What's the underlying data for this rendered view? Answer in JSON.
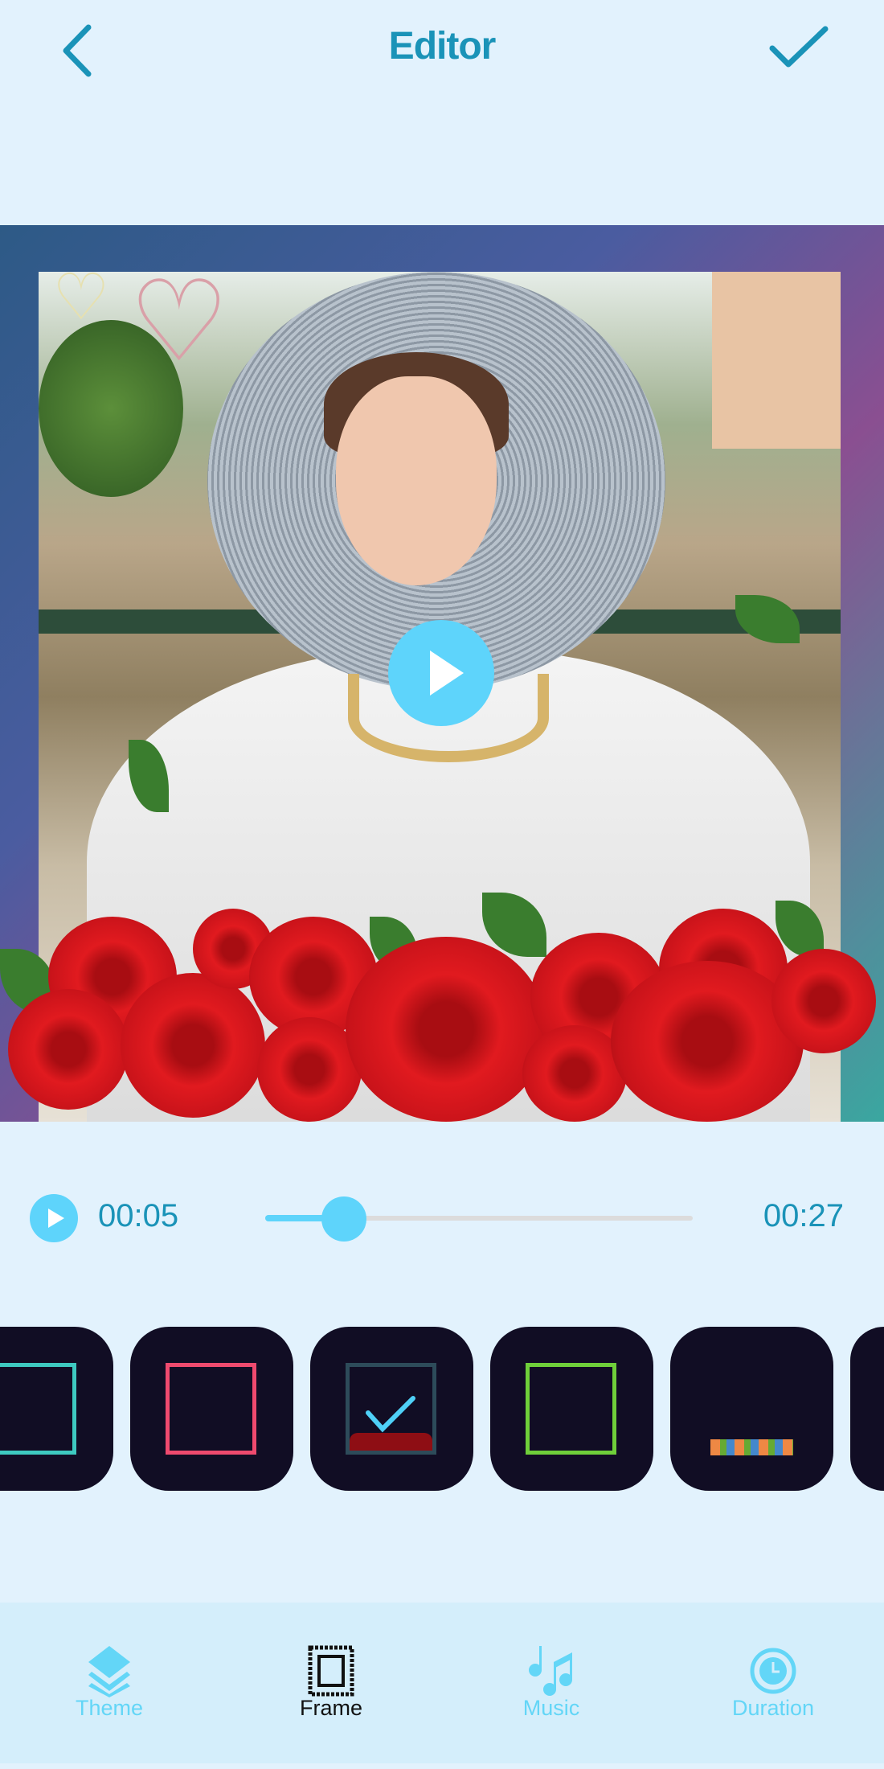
{
  "header": {
    "title": "Editor",
    "back_icon": "chevron-left-icon",
    "done_icon": "checkmark-icon",
    "accent": "#1a93b8"
  },
  "preview": {
    "play_icon": "play-icon"
  },
  "timeline": {
    "current": "00:05",
    "total": "00:27",
    "progress": 0.185,
    "play_icon": "play-icon"
  },
  "frames": {
    "items": [
      {
        "name": "floral-teal-frame",
        "selected": false,
        "border": "#3ec9c0"
      },
      {
        "name": "happy-birthday-pink-frame",
        "selected": false,
        "border": "#ef4a6e"
      },
      {
        "name": "roses-frame",
        "selected": true,
        "border": "#2d4b5a"
      },
      {
        "name": "i-love-you-green-frame",
        "selected": false,
        "border": "#6fcf3a"
      },
      {
        "name": "birthday-cakes-frame",
        "selected": false,
        "border": "transparent"
      },
      {
        "name": "frame-partial",
        "selected": false,
        "border": "transparent"
      }
    ]
  },
  "nav": {
    "items": [
      {
        "label": "Theme",
        "icon": "layers-icon",
        "active": false
      },
      {
        "label": "Frame",
        "icon": "frame-icon",
        "active": true
      },
      {
        "label": "Music",
        "icon": "music-notes-icon",
        "active": false
      },
      {
        "label": "Duration",
        "icon": "clock-icon",
        "active": false
      }
    ],
    "accent": "#63d6f7"
  }
}
